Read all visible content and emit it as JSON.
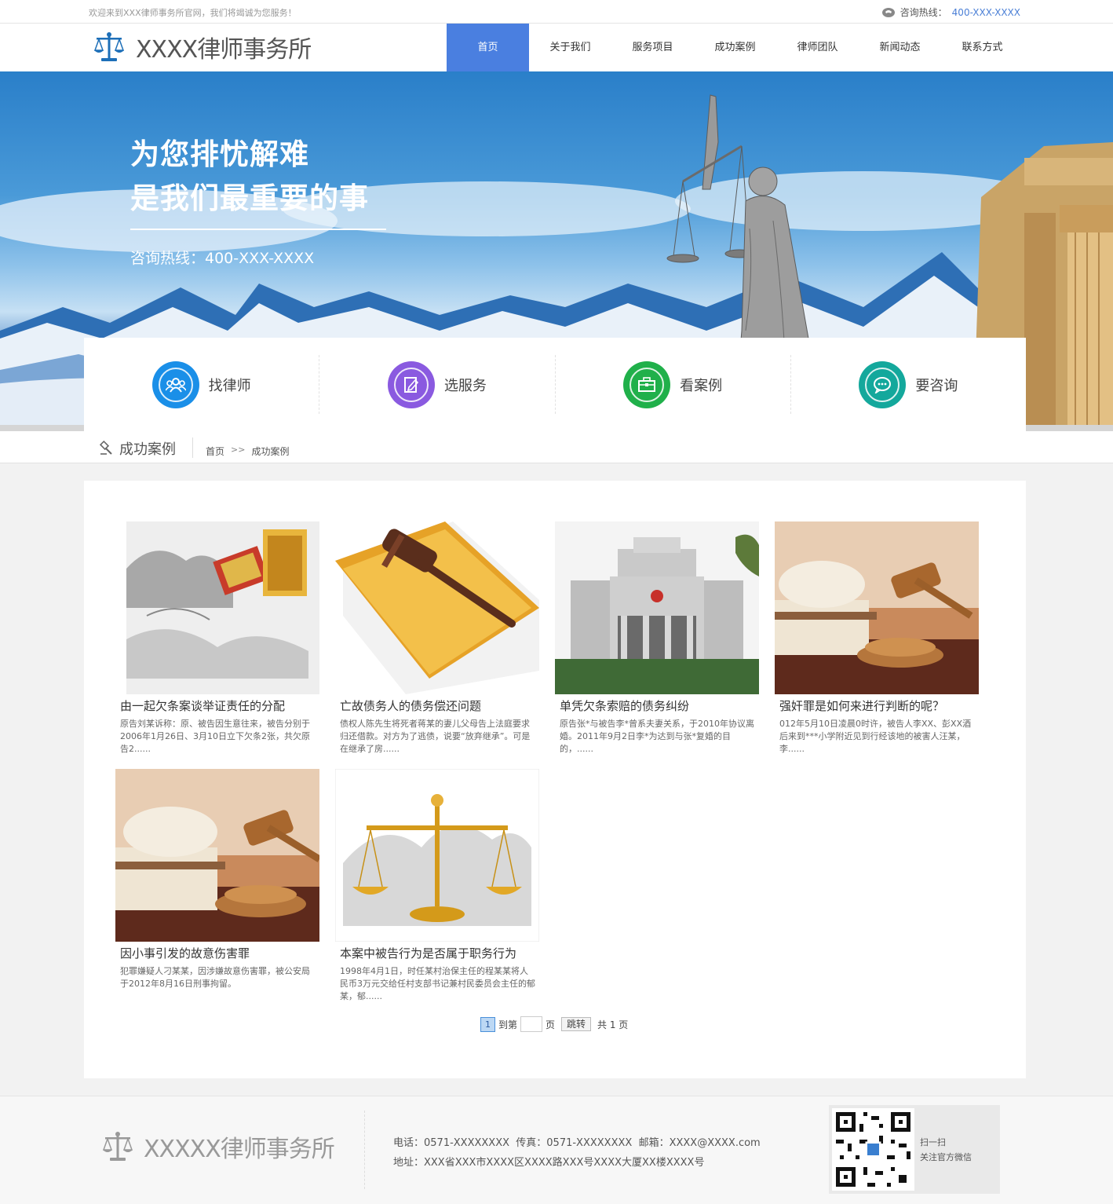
{
  "topbar": {
    "welcome": "欢迎来到XXX律师事务所官网，我们将竭诚为您服务！",
    "hotline_label": "咨询热线：",
    "hotline_number": "400-XXX-XXXX"
  },
  "header": {
    "logo_text": "XXXX律师事务所",
    "nav": [
      "首页",
      "关于我们",
      "服务项目",
      "成功案例",
      "律师团队",
      "新闻动态",
      "联系方式"
    ],
    "active_nav": "首页"
  },
  "banner": {
    "line1": "为您排忧解难",
    "line2": "是我们最重要的事",
    "hotline": "咨询热线：400-XXX-XXXX"
  },
  "quick_links": [
    {
      "label": "找律师",
      "icon": "group-icon",
      "color": "#1a8fe8"
    },
    {
      "label": "选服务",
      "icon": "document-edit-icon",
      "color": "#8a5ae0"
    },
    {
      "label": "看案例",
      "icon": "briefcase-icon",
      "color": "#20b04a"
    },
    {
      "label": "要咨询",
      "icon": "chat-icon",
      "color": "#14a89c"
    }
  ],
  "breadcrumb": {
    "section_title": "成功案例",
    "home": "首页",
    "sep": ">>",
    "current": "成功案例"
  },
  "cases": [
    {
      "title": "由一起欠条案谈举证责任的分配",
      "desc": "原告刘某诉称：原、被告因生意往来，被告分别于2006年1月26日、3月10日立下欠条2张，共欠原告2......"
    },
    {
      "title": "亡故债务人的债务偿还问题",
      "desc": "债权人陈先生将死者蒋某的妻儿父母告上法庭要求归还借款。对方为了逃债，说要“放弃继承”。可是在继承了房......"
    },
    {
      "title": "单凭欠条索赔的债务纠纷",
      "desc": "原告张*与被告李*曾系夫妻关系，于2010年协议离婚。2011年9月2日李*为达到与张*复婚的目的，......"
    },
    {
      "title": "强奸罪是如何来进行判断的呢？",
      "desc": "012年5月10日凌晨0时许，被告人李XX、彭XX酒后来到***小学附近见到行经该地的被害人汪某，李......"
    },
    {
      "title": "因小事引发的故意伤害罪",
      "desc": "犯罪嫌疑人刁某某，因涉嫌故意伤害罪，被公安局于2012年8月16日刑事拘留。"
    },
    {
      "title": "本案中被告行为是否属于职务行为",
      "desc": "1998年4月1日，时任某村治保主任的程某某将人民币3万元交给任村支部书记兼村民委员会主任的郁某，郁......"
    }
  ],
  "pager": {
    "current": "1",
    "goto_prefix": "到第",
    "goto_suffix": "页",
    "jump": "跳转",
    "total": "共 1 页"
  },
  "footer": {
    "logo_text": "XXXXX律师事务所",
    "line1": "电话：0571-XXXXXXXX  传真：0571-XXXXXXXX  邮箱：XXXX@XXXX.com",
    "line2": "地址：XXX省XXX市XXXX区XXXX路XXX号XXXX大厦XX楼XXXX号",
    "qr_line1": "扫一扫",
    "qr_line2": "关注官方微信"
  }
}
